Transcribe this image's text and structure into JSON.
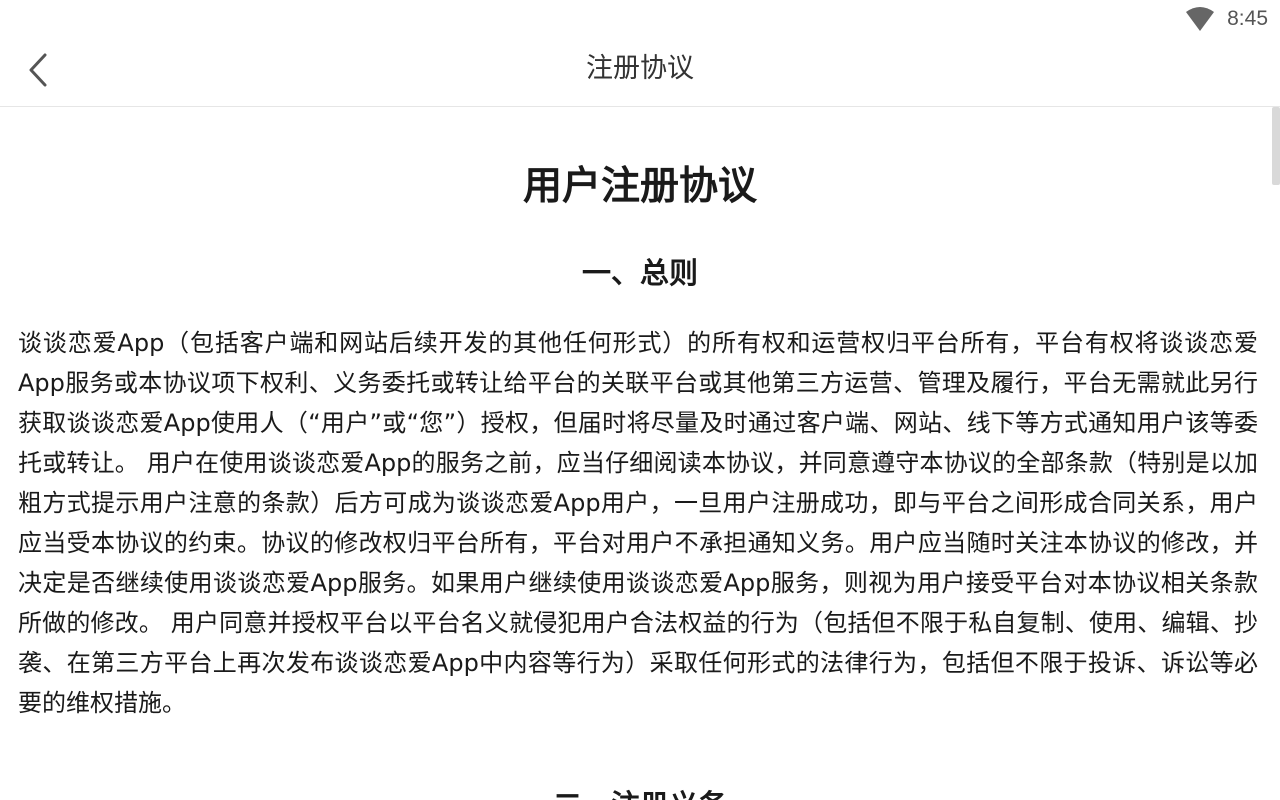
{
  "status_bar": {
    "time": "8:45",
    "wifi_icon": "wifi-icon"
  },
  "app_bar": {
    "back_icon": "chevron-left-icon",
    "title": "注册协议"
  },
  "document": {
    "title": "用户注册协议",
    "sections": [
      {
        "heading": "一、总则",
        "paragraph": "谈谈恋爱App（包括客户端和网站后续开发的其他任何形式）的所有权和运营权归平台所有，平台有权将谈谈恋爱App服务或本协议项下权利、义务委托或转让给平台的关联平台或其他第三方运营、管理及履行，平台无需就此另行获取谈谈恋爱App使用人（“用户”或“您”）授权，但届时将尽量及时通过客户端、网站、线下等方式通知用户该等委托或转让。 用户在使用谈谈恋爱App的服务之前，应当仔细阅读本协议，并同意遵守本协议的全部条款（特别是以加粗方式提示用户注意的条款）后方可成为谈谈恋爱App用户，一旦用户注册成功，即与平台之间形成合同关系，用户应当受本协议的约束。协议的修改权归平台所有，平台对用户不承担通知义务。用户应当随时关注本协议的修改，并决定是否继续使用谈谈恋爱App服务。如果用户继续使用谈谈恋爱App服务，则视为用户接受平台对本协议相关条款所做的修改。 用户同意并授权平台以平台名义就侵犯用户合法权益的行为（包括但不限于私自复制、使用、编辑、抄袭、在第三方平台上再次发布谈谈恋爱App中内容等行为）采取任何形式的法律行为，包括但不限于投诉、诉讼等必要的维权措施。"
      },
      {
        "heading": "二、注册义务"
      }
    ]
  }
}
